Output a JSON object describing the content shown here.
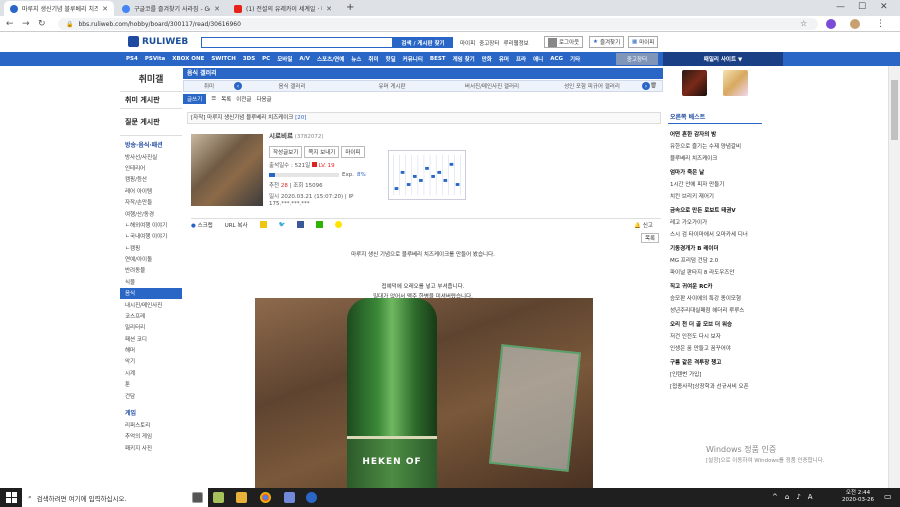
{
  "browser": {
    "tabs": [
      {
        "title": "마루지 생신기념 블루베리 치즈케",
        "active": true,
        "color": "#2a66c6"
      },
      {
        "title": "구글코를 즐겨찾기 사라짐 - Goo",
        "active": false,
        "color": "#4285f4"
      },
      {
        "title": "(1) 전설의 유레카이 세계일 · 내",
        "active": false,
        "color": "#e62117"
      }
    ],
    "new_tab": "+",
    "url": "bbs.ruliweb.com/hobby/board/300117/read/30616960"
  },
  "header": {
    "logo": "RULIWEB",
    "search_button": "검색 / 게시판 찾기",
    "links": [
      "마이피",
      "중고장터",
      "루리웹정보"
    ],
    "login": "로그아웃",
    "bookmark": "즐겨찾기",
    "myspace": "마이피"
  },
  "nav": {
    "items": [
      "PS4",
      "PSVita",
      "XBOX ONE",
      "SWITCH",
      "3DS",
      "PC",
      "모바일",
      "A/V",
      "스포츠/연예",
      "뉴스",
      "취미",
      "핫딜",
      "커뮤니티",
      "BEST",
      "게임 찾기",
      "만화",
      "유머",
      "프라",
      "애니",
      "ACG",
      "기타"
    ],
    "used_market": "중고장터",
    "related_sites": "패밀리 사이트 ▼"
  },
  "left_sidebar": {
    "title": "취미갤",
    "boards": [
      "취미 게시판",
      "질문 게시판"
    ],
    "section": "방송·음식·패션",
    "items": [
      "방사선/사진실",
      "인테리어",
      "캠핑/등산",
      "레어 아이템",
      "자작/손만들",
      "여행/산/동경",
      "ㄴ해외여행 이야기",
      "ㄴ국내여행 이야기",
      "ㄴ캠핑",
      "연예/아이돌",
      "반려동물",
      "식물",
      "음식",
      "내시진/메인사진",
      "코스프레",
      "밀리터리",
      "패션 코디",
      "해머",
      "악기",
      "시계",
      "툰",
      "건담"
    ],
    "selected": "음식",
    "section2": "게임",
    "items2": [
      "리퍼스토리",
      "추억의 게임",
      "패키지 사진"
    ]
  },
  "board": {
    "title": "음식 갤러리",
    "categories": [
      "취미",
      "음식 갤러리",
      "유머 게시판",
      "버서진/메인사진 갤러리",
      "성인 포함 피규어 갤러리"
    ],
    "subtabs": [
      "글쓰기",
      "목록",
      "이전글",
      "다음글"
    ],
    "post_prefix": "[자작] 마루지 생신기념 블루베리 치즈케이크",
    "comment_count": "[20]"
  },
  "user": {
    "name": "시로비르",
    "id": "(3782072)",
    "buttons": [
      "작성글보기",
      "쪽지 보내기",
      "마이피"
    ],
    "posts_label": "출석일수 : 521일",
    "level": "LV. 19",
    "exp_label": "Exp.",
    "exp_percent": "8%",
    "exp_fill": 0.08,
    "recommend_label": "추천",
    "recommend": "28",
    "views_label": "조회",
    "views": "15096",
    "date": "일시 2020.03.21 (15:07:20)",
    "ip_label": "IP",
    "ip": "175.***.***.***"
  },
  "chart_data": {
    "type": "bar",
    "values": [
      2,
      6,
      3,
      5,
      4,
      7,
      5,
      6,
      4,
      8,
      3
    ],
    "ylim": [
      0,
      10
    ]
  },
  "actions": {
    "scrap": "스크랩",
    "url_copy": "URL 복사",
    "report": "신고",
    "list_button": "목록"
  },
  "content": {
    "line1": "마루지 생신 기념으로 블루베리 치즈케이크를 만들어 봤습니다.",
    "line2": "접예덕에 오레오를 넣고 부셔줍니다.",
    "line3": "밀대가 없어서 맥주 한병을 미셔버렸습니다.",
    "bottle_text": "HEKEN OF"
  },
  "right_sidebar": {
    "best_title": "오른쪽 베스트",
    "entries": [
      {
        "text": "어떤 흔한 감자의 밤",
        "bold": true
      },
      {
        "text": "유한으로 즐기는 수제 양념갈비",
        "bold": false
      },
      {
        "text": "블루베리 치즈케이크",
        "bold": false
      },
      {
        "text": "엄마가 죽은 날",
        "bold": true
      },
      {
        "text": "1시간 안에 피자 만들기",
        "bold": false
      },
      {
        "text": "치킨 브리키 재어기",
        "bold": false
      },
      {
        "text": "금속으로 만든 로보트 태권V",
        "bold": true
      },
      {
        "text": "레고 가오가이가",
        "bold": false
      },
      {
        "text": "스시 검 타이마에서 오마카세 디너",
        "bold": false
      },
      {
        "text": "기동경개가 B 레이더",
        "bold": true
      },
      {
        "text": "MG 프리덤 건담 2.0",
        "bold": false
      },
      {
        "text": "파이널 판타지 8 라도우즈안",
        "bold": false
      },
      {
        "text": "직고 귀여운 RC카",
        "bold": true
      },
      {
        "text": "승모판 사이에의 특강 종이모형",
        "bold": false
      },
      {
        "text": "성년주리대실패점 헤더리 루루스",
        "bold": false
      },
      {
        "text": "오리 천 더 골 모브 더 워승",
        "bold": true
      },
      {
        "text": "저건 인전도 다시 보자",
        "bold": false
      },
      {
        "text": "인생은 꿈 만들고 꿈꾸어야",
        "bold": false
      },
      {
        "text": "구름 같은 격투장 챙고",
        "bold": true
      },
      {
        "text": "[인텐번 가입]",
        "bold": false
      },
      {
        "text": "[접종사작]상장학과 선규서비 오픈",
        "bold": false
      }
    ]
  },
  "watermark": {
    "title": "Windows 정품 인증",
    "sub": "[설정]으로 이동하여 Windows를 정품 인증합니다."
  },
  "taskbar": {
    "search_placeholder": "검색하려면 여기에 입력하십시오.",
    "time": "오전 2:44",
    "date": "2020-03-26"
  },
  "colors": {
    "accent": "#2a66c6",
    "dark_accent": "#1b3f85"
  }
}
